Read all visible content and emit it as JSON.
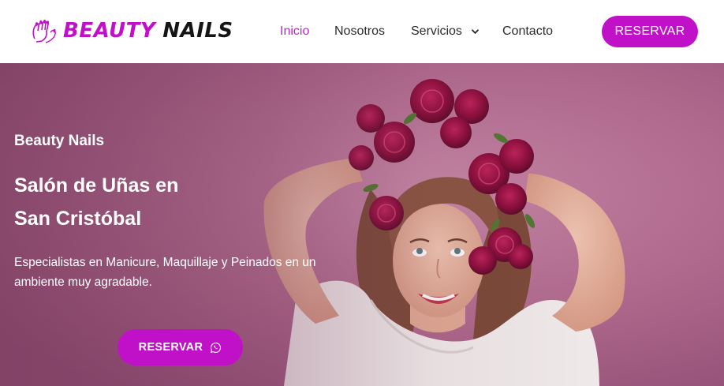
{
  "brand": {
    "word1": "BEAUTY",
    "word2": "NAILS",
    "logo_icon": "hands-with-painted-nails-icon",
    "accent_color": "#c010c8"
  },
  "nav": {
    "items": [
      {
        "label": "Inicio",
        "active": true
      },
      {
        "label": "Nosotros",
        "active": false
      },
      {
        "label": "Servicios",
        "active": false,
        "has_dropdown": true
      },
      {
        "label": "Contacto",
        "active": false
      }
    ],
    "cta_label": "RESERVAR"
  },
  "hero": {
    "kicker": "Beauty Nails",
    "title_line1": "Salón de Uñas en",
    "title_line2": "San Cristóbal",
    "description": "Especialistas en Manicure, Maquillaje y Peinados en un ambiente muy agradable.",
    "cta_label": "RESERVAR",
    "cta_icon": "whatsapp-icon",
    "image": "smiling-woman-with-flower-crown-photo",
    "background_color": "#a1587e"
  }
}
